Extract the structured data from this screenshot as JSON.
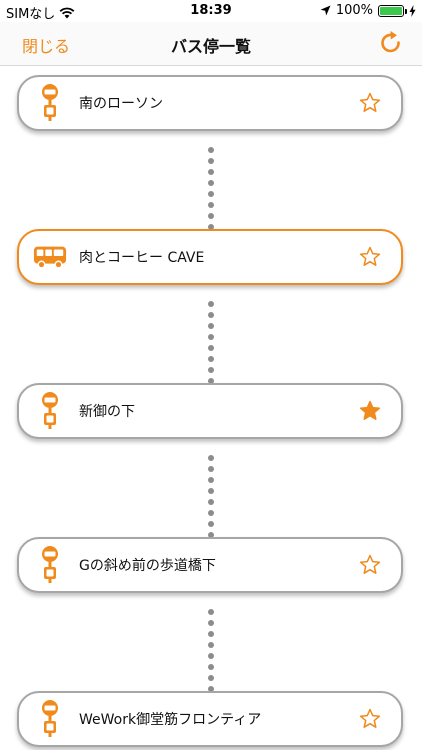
{
  "status_bar": {
    "carrier": "SIMなし",
    "time": "18:39",
    "battery": "100%",
    "battery_level": 1.0,
    "icons": [
      "wifi-icon",
      "location-arrow-icon",
      "battery-icon",
      "charging-bolt-icon"
    ]
  },
  "nav": {
    "close_label": "閉じる",
    "title": "バス停一覧",
    "refresh_icon": "refresh-icon"
  },
  "colors": {
    "accent": "#f08a1c",
    "card_border": "#a6a6a6",
    "dot": "#8c8c8c"
  },
  "stops": [
    {
      "name": "南のローソン",
      "icon": "bus-stop-icon",
      "favorite": false,
      "current": false
    },
    {
      "name": "肉とコーヒー CAVE",
      "icon": "bus-icon",
      "favorite": false,
      "current": true
    },
    {
      "name": "新御の下",
      "icon": "bus-stop-icon",
      "favorite": true,
      "current": false
    },
    {
      "name": "Gの斜め前の歩道橋下",
      "icon": "bus-stop-icon",
      "favorite": false,
      "current": false
    },
    {
      "name": "WeWork御堂筋フロンティア",
      "icon": "bus-stop-icon",
      "favorite": false,
      "current": false
    }
  ]
}
